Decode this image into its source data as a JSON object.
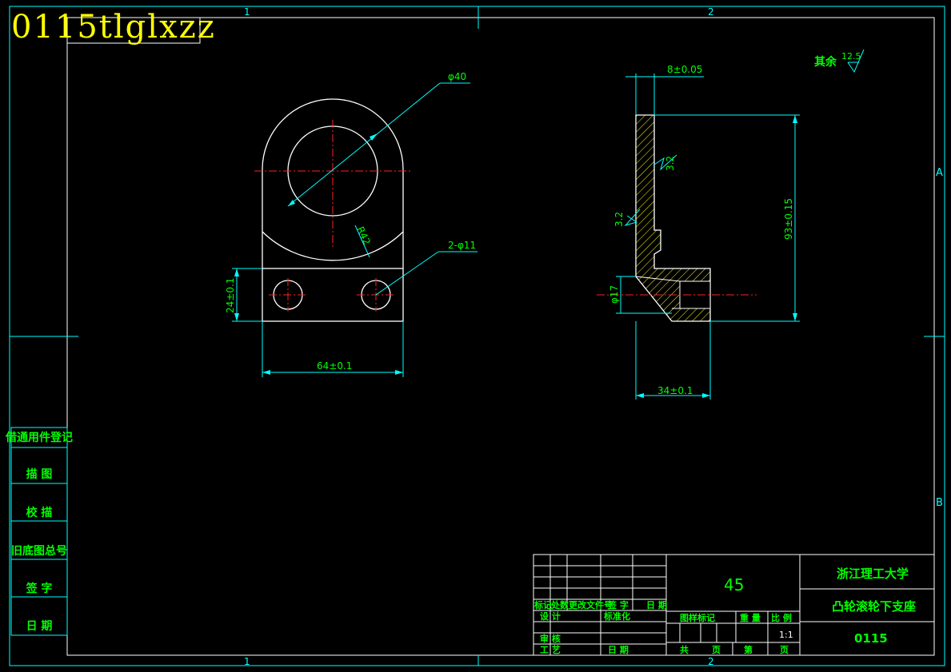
{
  "overlay_title": "0115tlglxzz",
  "zone_labels": {
    "col1": "1",
    "col2": "2",
    "rowA": "A",
    "rowB": "B",
    "scale_text": "1:1"
  },
  "dims": {
    "front_phi": "φ40",
    "front_radius": "R42",
    "front_holes": "2-φ11",
    "front_height": "24±0.1",
    "front_width": "64±0.1",
    "side_thickness": "8±0.05",
    "side_height": "93±0.15",
    "side_bore": "φ17",
    "side_depth": "34±0.1",
    "rough_1": "3.2",
    "rough_2": "3.2",
    "rough_other_label": "其余",
    "rough_other_value": "12.5"
  },
  "left_table": {
    "labels": [
      "借通用件登记",
      "描 图",
      "校 描",
      "旧底图总号",
      "签 字",
      "日 期"
    ]
  },
  "title_block": {
    "material": "45",
    "school": "浙江理工大学",
    "part_name": "凸轮滚轮下支座",
    "drawing_no": "0115",
    "rev_headers": [
      "标记",
      "处数",
      "更改文件号",
      "签 字",
      "日 期"
    ],
    "design": "设 计",
    "standard": "标准化",
    "check": "审 核",
    "process": "工 艺",
    "date": "日 期",
    "stage_mark": "图样标记",
    "weight": "重 量",
    "ratio": "比 例",
    "total": "共",
    "sheet": "第",
    "page": "页",
    "page2": "页"
  }
}
